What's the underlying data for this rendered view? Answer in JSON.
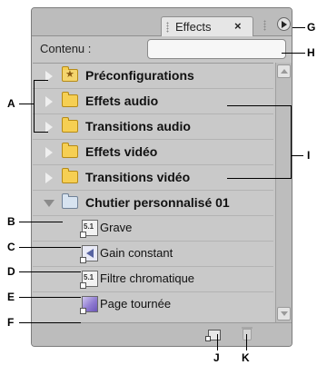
{
  "panel": {
    "tab_label": "Effects",
    "tab_close": "×",
    "search_label": "Contenu :",
    "search_value": "",
    "search_placeholder": ""
  },
  "tree": [
    {
      "label": "Préconfigurations",
      "icon": "preset-folder-icon",
      "expanded": false
    },
    {
      "label": "Effets audio",
      "icon": "folder-icon",
      "expanded": false
    },
    {
      "label": "Transitions audio",
      "icon": "folder-icon",
      "expanded": false
    },
    {
      "label": "Effets vidéo",
      "icon": "folder-icon",
      "expanded": false
    },
    {
      "label": "Transitions vidéo",
      "icon": "folder-icon",
      "expanded": false
    },
    {
      "label": "Chutier personnalisé 01",
      "icon": "custom-bin-icon",
      "expanded": true
    }
  ],
  "bin_items": [
    {
      "label": "Grave",
      "icon": "audio-51-effect-icon",
      "glyph": "5.1"
    },
    {
      "label": "Gain constant",
      "icon": "audio-transition-icon",
      "glyph": ""
    },
    {
      "label": "Filtre chromatique",
      "icon": "video-effect-icon",
      "glyph": "5.1"
    },
    {
      "label": "Page tournée",
      "icon": "video-transition-icon",
      "glyph": ""
    }
  ],
  "callouts": {
    "A": "A",
    "B": "B",
    "C": "C",
    "D": "D",
    "E": "E",
    "F": "F",
    "G": "G",
    "H": "H",
    "I": "I",
    "J": "J",
    "K": "K"
  }
}
